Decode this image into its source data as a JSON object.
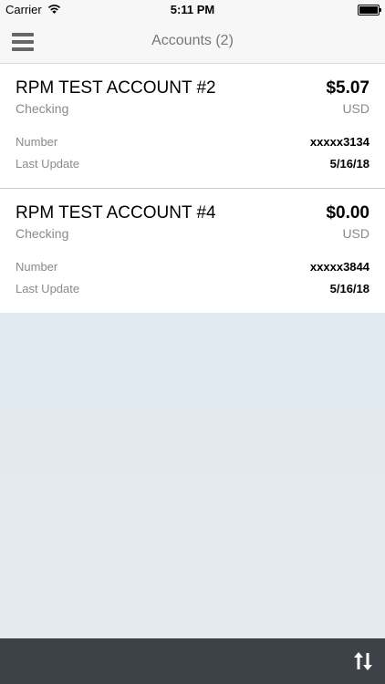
{
  "status_bar": {
    "carrier": "Carrier",
    "time": "5:11 PM"
  },
  "header": {
    "title": "Accounts (2)",
    "menu_icon": "hamburger-menu-icon"
  },
  "accounts": [
    {
      "name": "RPM TEST ACCOUNT #2",
      "type": "Checking",
      "balance": "$5.07",
      "currency": "USD",
      "number_label": "Number",
      "number": "xxxxx3134",
      "update_label": "Last Update",
      "last_update": "5/16/18"
    },
    {
      "name": "RPM TEST ACCOUNT #4",
      "type": "Checking",
      "balance": "$0.00",
      "currency": "USD",
      "number_label": "Number",
      "number": "xxxxx3844",
      "update_label": "Last Update",
      "last_update": "5/16/18"
    }
  ],
  "bottom_bar": {
    "action_icon": "transfer-arrows-icon"
  },
  "colors": {
    "navbar_bg": "#f7f7f7",
    "bottom_bar_bg": "#3d4249",
    "secondary_text": "#8a8a8a"
  }
}
